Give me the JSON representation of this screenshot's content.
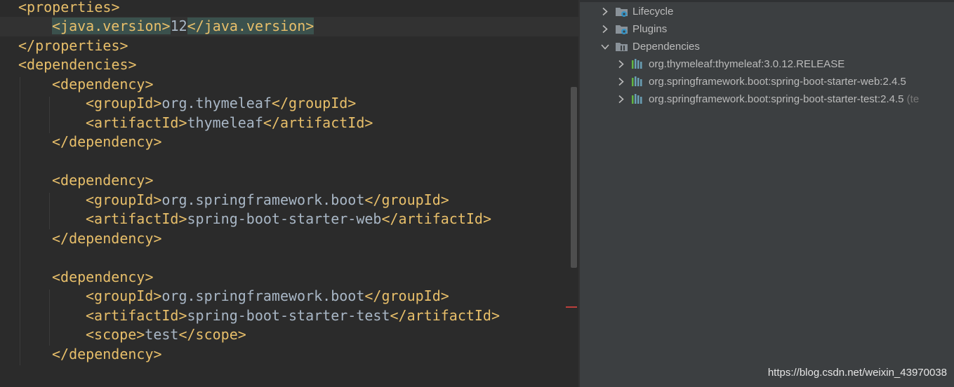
{
  "editor": {
    "lines": [
      [
        {
          "t": "<properties>",
          "c": "tag"
        }
      ],
      [
        {
          "t": "<java.version>",
          "c": "tag hl"
        },
        {
          "t": "12",
          "c": "text"
        },
        {
          "t": "</java.version>",
          "c": "tag hl"
        }
      ],
      [
        {
          "t": "</properties>",
          "c": "tag"
        }
      ],
      [
        {
          "t": "<dependencies>",
          "c": "tag"
        }
      ],
      [
        {
          "t": "<dependency>",
          "c": "tag"
        }
      ],
      [
        {
          "t": "<groupId>",
          "c": "tag"
        },
        {
          "t": "org.thymeleaf",
          "c": "text"
        },
        {
          "t": "</groupId>",
          "c": "tag"
        }
      ],
      [
        {
          "t": "<artifactId>",
          "c": "tag"
        },
        {
          "t": "thymeleaf",
          "c": "text"
        },
        {
          "t": "</artifactId>",
          "c": "tag"
        }
      ],
      [
        {
          "t": "</dependency>",
          "c": "tag"
        }
      ],
      [],
      [
        {
          "t": "<dependency>",
          "c": "tag"
        }
      ],
      [
        {
          "t": "<groupId>",
          "c": "tag"
        },
        {
          "t": "org.springframework.boot",
          "c": "text"
        },
        {
          "t": "</groupId>",
          "c": "tag"
        }
      ],
      [
        {
          "t": "<artifactId>",
          "c": "tag"
        },
        {
          "t": "spring-boot-starter-web",
          "c": "text"
        },
        {
          "t": "</artifactId>",
          "c": "tag"
        }
      ],
      [
        {
          "t": "</dependency>",
          "c": "tag"
        }
      ],
      [],
      [
        {
          "t": "<dependency>",
          "c": "tag"
        }
      ],
      [
        {
          "t": "<groupId>",
          "c": "tag"
        },
        {
          "t": "org.springframework.boot",
          "c": "text"
        },
        {
          "t": "</groupId>",
          "c": "tag"
        }
      ],
      [
        {
          "t": "<artifactId>",
          "c": "tag"
        },
        {
          "t": "spring-boot-starter-test",
          "c": "text"
        },
        {
          "t": "</artifactId>",
          "c": "tag"
        }
      ],
      [
        {
          "t": "<scope>",
          "c": "tag"
        },
        {
          "t": "test",
          "c": "text"
        },
        {
          "t": "</scope>",
          "c": "tag"
        }
      ],
      [
        {
          "t": "</dependency>",
          "c": "tag"
        }
      ]
    ]
  },
  "maven_tree": {
    "lifecycle_label": "Lifecycle",
    "plugins_label": "Plugins",
    "dependencies_label": "Dependencies",
    "dependencies": [
      {
        "label": "org.thymeleaf:thymeleaf:3.0.12.RELEASE",
        "suffix": ""
      },
      {
        "label": "org.springframework.boot:spring-boot-starter-web:2.4.5",
        "suffix": ""
      },
      {
        "label": "org.springframework.boot:spring-boot-starter-test:2.4.5",
        "suffix": " (te"
      }
    ]
  },
  "watermark": "https://blog.csdn.net/weixin_43970038",
  "colors": {
    "editor_bg": "#2b2b2b",
    "xml_tag": "#e8bf6a",
    "text": "#a9b7c6",
    "panel_bg": "#3c3f41",
    "tree_text": "#bbbbbb",
    "dependency_icon": "#6a9fb5",
    "error_mark": "#bc3f3c"
  }
}
